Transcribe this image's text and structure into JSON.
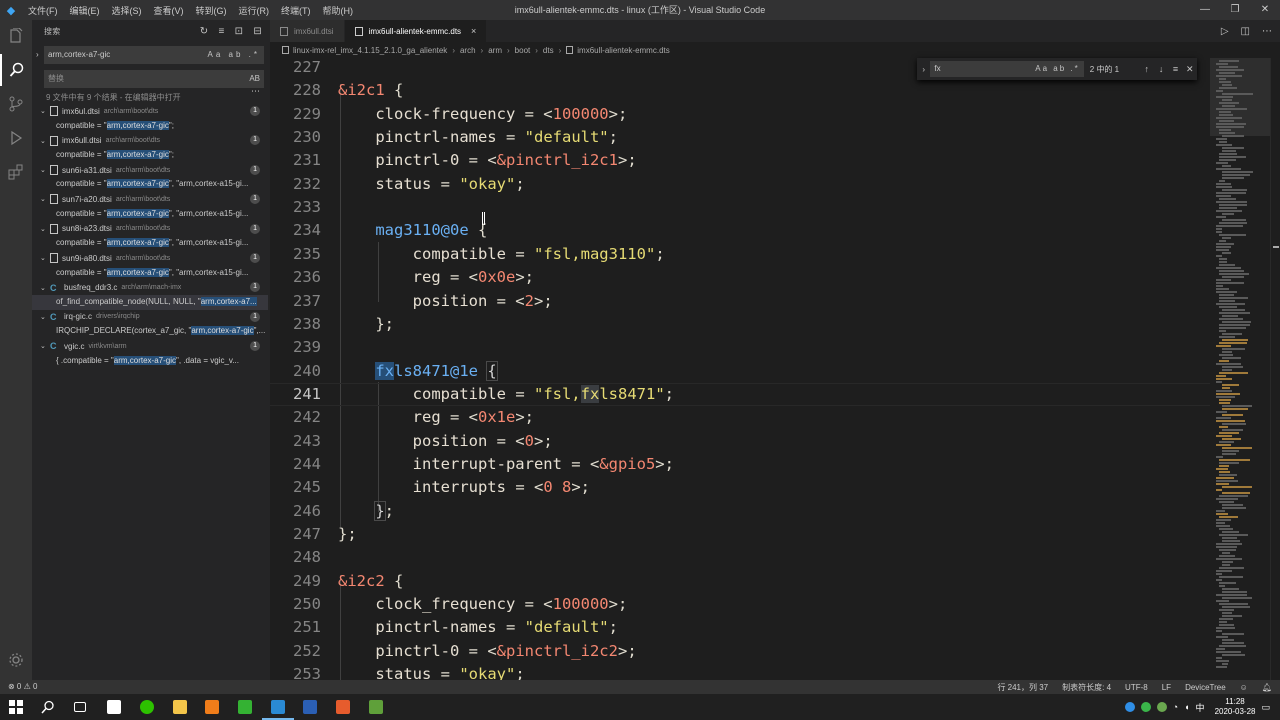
{
  "window": {
    "menu": [
      "文件(F)",
      "编辑(E)",
      "选择(S)",
      "查看(V)",
      "转到(G)",
      "运行(R)",
      "终端(T)",
      "帮助(H)"
    ],
    "title": "imx6ull-alientek-emmc.dts - linux (工作区) - Visual Studio Code",
    "controls": [
      "—",
      "❐",
      "✕"
    ]
  },
  "sidebar": {
    "header": "搜索",
    "search_value": "arm,cortex-a7-gic",
    "search_opts": "Aa ab .*",
    "replace_placeholder": "替换",
    "replace_opt": "AB",
    "summary": "9 文件中有 9 个结果 - 在编辑器中打开",
    "results": [
      {
        "file": "imx6ul.dtsi",
        "path": "arch\\arm\\boot\\dts",
        "count": "1",
        "icon": "file",
        "pre": "compatible = \"",
        "hit": "arm,cortex-a7-gic",
        "post": "\";"
      },
      {
        "file": "imx6ull.dtsi",
        "path": "arch\\arm\\boot\\dts",
        "count": "1",
        "icon": "file",
        "pre": "compatible = \"",
        "hit": "arm,cortex-a7-gic",
        "post": "\";"
      },
      {
        "file": "sun6i-a31.dtsi",
        "path": "arch\\arm\\boot\\dts",
        "count": "1",
        "icon": "file",
        "pre": "compatible = \"",
        "hit": "arm,cortex-a7-gic",
        "post": "\", \"arm,cortex-a15-gi..."
      },
      {
        "file": "sun7i-a20.dtsi",
        "path": "arch\\arm\\boot\\dts",
        "count": "1",
        "icon": "file",
        "pre": "compatible = \"",
        "hit": "arm,cortex-a7-gic",
        "post": "\", \"arm,cortex-a15-gi..."
      },
      {
        "file": "sun8i-a23.dtsi",
        "path": "arch\\arm\\boot\\dts",
        "count": "1",
        "icon": "file",
        "pre": "compatible = \"",
        "hit": "arm,cortex-a7-gic",
        "post": "\", \"arm,cortex-a15-gi..."
      },
      {
        "file": "sun9i-a80.dtsi",
        "path": "arch\\arm\\boot\\dts",
        "count": "1",
        "icon": "file",
        "pre": "compatible = \"",
        "hit": "arm,cortex-a7-gic",
        "post": "\", \"arm,cortex-a15-gi..."
      },
      {
        "file": "busfreq_ddr3.c",
        "path": "arch\\arm\\mach-imx",
        "count": "1",
        "icon": "c",
        "pre": "of_find_compatible_node(NULL, NULL, \"",
        "hit": "arm,cortex-a7...",
        "post": ""
      },
      {
        "file": "irq-gic.c",
        "path": "drivers\\irqchip",
        "count": "1",
        "icon": "c",
        "pre": "IRQCHIP_DECLARE(cortex_a7_gic, \"",
        "hit": "arm,cortex-a7-gic",
        "post": "\",..."
      },
      {
        "file": "vgic.c",
        "path": "virt\\kvm\\arm",
        "count": "1",
        "icon": "c",
        "pre": "{ .compatible = \"",
        "hit": "arm,cortex-a7-gic",
        "post": "\",       .data = vgic_v..."
      }
    ]
  },
  "tabs": [
    {
      "label": "imx6ull.dtsi",
      "active": false
    },
    {
      "label": "imx6ull-alientek-emmc.dts",
      "active": true,
      "close": "×"
    }
  ],
  "breadcrumbs": [
    "linux-imx-rel_imx_4.1.15_2.1.0_ga_alientek",
    "arch",
    "arm",
    "boot",
    "dts",
    "imx6ull-alientek-emmc.dts"
  ],
  "find": {
    "value": "fx",
    "opts": "Aa ab .*",
    "count": "2 中的 1"
  },
  "code": [
    {
      "n": "227",
      "t": [
        [
          "plain",
          ""
        ]
      ]
    },
    {
      "n": "228",
      "t": [
        [
          "label",
          "&i2c1"
        ],
        [
          "plain",
          " {"
        ]
      ]
    },
    {
      "n": "229",
      "t": [
        [
          "plain",
          "    "
        ],
        [
          "key",
          "clock-frequency"
        ],
        [
          "plain",
          " = <"
        ],
        [
          "num",
          "100000"
        ],
        [
          "plain",
          ">;"
        ]
      ]
    },
    {
      "n": "230",
      "t": [
        [
          "plain",
          "    "
        ],
        [
          "key",
          "pinctrl-names"
        ],
        [
          "plain",
          " = "
        ],
        [
          "str",
          "\"default\""
        ],
        [
          "plain",
          ";"
        ]
      ]
    },
    {
      "n": "231",
      "t": [
        [
          "plain",
          "    "
        ],
        [
          "key",
          "pinctrl-0"
        ],
        [
          "plain",
          " = <"
        ],
        [
          "ref",
          "&pinctrl_i2c1"
        ],
        [
          "plain",
          ">;"
        ]
      ]
    },
    {
      "n": "232",
      "t": [
        [
          "plain",
          "    "
        ],
        [
          "key",
          "status"
        ],
        [
          "plain",
          " = "
        ],
        [
          "str",
          "\"okay\""
        ],
        [
          "plain",
          ";"
        ]
      ]
    },
    {
      "n": "233",
      "t": [
        [
          "plain",
          ""
        ]
      ]
    },
    {
      "n": "234",
      "t": [
        [
          "plain",
          "    "
        ],
        [
          "node",
          "mag3110@0e"
        ],
        [
          "plain",
          " {"
        ]
      ]
    },
    {
      "n": "235",
      "t": [
        [
          "plain",
          "        "
        ],
        [
          "key",
          "compatible"
        ],
        [
          "plain",
          " = "
        ],
        [
          "str",
          "\"fsl,mag3110\""
        ],
        [
          "plain",
          ";"
        ]
      ]
    },
    {
      "n": "236",
      "t": [
        [
          "plain",
          "        "
        ],
        [
          "key",
          "reg"
        ],
        [
          "plain",
          " = <"
        ],
        [
          "num",
          "0x0e"
        ],
        [
          "plain",
          ">;"
        ]
      ]
    },
    {
      "n": "237",
      "t": [
        [
          "plain",
          "        "
        ],
        [
          "key",
          "position"
        ],
        [
          "plain",
          " = <"
        ],
        [
          "num",
          "2"
        ],
        [
          "plain",
          ">;"
        ]
      ]
    },
    {
      "n": "238",
      "t": [
        [
          "plain",
          "    };"
        ]
      ]
    },
    {
      "n": "239",
      "t": [
        [
          "plain",
          ""
        ]
      ]
    },
    {
      "n": "240",
      "t": [
        [
          "plain",
          "    "
        ],
        [
          "nodehl",
          "fx"
        ],
        [
          "node",
          "ls8471@1e"
        ],
        [
          "plain",
          " "
        ],
        [
          "brace",
          "{"
        ]
      ]
    },
    {
      "n": "241",
      "t": [
        [
          "plain",
          "        "
        ],
        [
          "key",
          "compatible"
        ],
        [
          "plain",
          " = "
        ],
        [
          "str",
          "\"fsl,"
        ],
        [
          "strhl",
          "fx"
        ],
        [
          "str",
          "ls8471\""
        ],
        [
          "plain",
          ";"
        ]
      ]
    },
    {
      "n": "242",
      "t": [
        [
          "plain",
          "        "
        ],
        [
          "key",
          "reg"
        ],
        [
          "plain",
          " = <"
        ],
        [
          "num",
          "0x1e"
        ],
        [
          "plain",
          ">;"
        ]
      ]
    },
    {
      "n": "243",
      "t": [
        [
          "plain",
          "        "
        ],
        [
          "key",
          "position"
        ],
        [
          "plain",
          " = <"
        ],
        [
          "num",
          "0"
        ],
        [
          "plain",
          ">;"
        ]
      ]
    },
    {
      "n": "244",
      "t": [
        [
          "plain",
          "        "
        ],
        [
          "key",
          "interrupt-parent"
        ],
        [
          "plain",
          " = <"
        ],
        [
          "ref",
          "&gpio5"
        ],
        [
          "plain",
          ">;"
        ]
      ]
    },
    {
      "n": "245",
      "t": [
        [
          "plain",
          "        "
        ],
        [
          "key",
          "interrupts"
        ],
        [
          "plain",
          " = <"
        ],
        [
          "num",
          "0 8"
        ],
        [
          "plain",
          ">;"
        ]
      ]
    },
    {
      "n": "246",
      "t": [
        [
          "plain",
          "    "
        ],
        [
          "brace",
          "}"
        ],
        [
          "plain",
          ";"
        ]
      ]
    },
    {
      "n": "247",
      "t": [
        [
          "plain",
          "};"
        ]
      ]
    },
    {
      "n": "248",
      "t": [
        [
          "plain",
          ""
        ]
      ]
    },
    {
      "n": "249",
      "t": [
        [
          "label",
          "&i2c2"
        ],
        [
          "plain",
          " {"
        ]
      ]
    },
    {
      "n": "250",
      "t": [
        [
          "plain",
          "    "
        ],
        [
          "key",
          "clock_frequency"
        ],
        [
          "plain",
          " = <"
        ],
        [
          "num",
          "100000"
        ],
        [
          "plain",
          ">;"
        ]
      ]
    },
    {
      "n": "251",
      "t": [
        [
          "plain",
          "    "
        ],
        [
          "key",
          "pinctrl-names"
        ],
        [
          "plain",
          " = "
        ],
        [
          "str",
          "\"default\""
        ],
        [
          "plain",
          ";"
        ]
      ]
    },
    {
      "n": "252",
      "t": [
        [
          "plain",
          "    "
        ],
        [
          "key",
          "pinctrl-0"
        ],
        [
          "plain",
          " = <"
        ],
        [
          "ref",
          "&pinctrl_i2c2"
        ],
        [
          "plain",
          ">;"
        ]
      ]
    },
    {
      "n": "253",
      "t": [
        [
          "plain",
          "    "
        ],
        [
          "key",
          "status"
        ],
        [
          "plain",
          " = "
        ],
        [
          "str",
          "\"okay\""
        ],
        [
          "plain",
          ";"
        ]
      ]
    }
  ],
  "active_line": "241",
  "status": {
    "problems": "⊗ 0 ⚠ 0",
    "position": "行 241，列 37",
    "tab_size": "制表符长度: 4",
    "encoding": "UTF-8",
    "eol": "LF",
    "language": "DeviceTree"
  },
  "taskbar": {
    "time": "11:28",
    "date": "2020-03-28"
  }
}
